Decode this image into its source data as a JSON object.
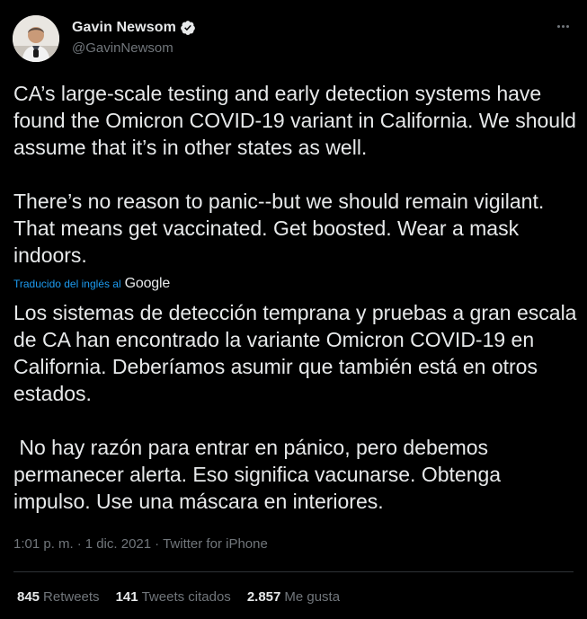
{
  "author": {
    "name": "Gavin Newsom",
    "handle": "@GavinNewsom"
  },
  "tweet": {
    "original_text": "CA’s large-scale testing and early detection systems have found the Omicron COVID-19 variant in California. We should assume that it’s in other states as well.\n\nThere’s no reason to panic--but we should remain vigilant. That means get vaccinated. Get boosted. Wear a mask indoors.",
    "translated_by_label": "Traducido del inglés al",
    "translator_brand": "Google",
    "translated_text": "Los sistemas de detección temprana y pruebas a gran escala de CA han encontrado la variante Omicron COVID-19 en California. Deberíamos asumir que también está en otros estados.\n\n No hay razón para entrar en pánico, pero debemos permanecer alerta. Eso significa vacunarse. Obtenga impulso. Use una máscara en interiores."
  },
  "meta": {
    "time": "1:01 p. m.",
    "sep1": "·",
    "date": "1 dic. 2021",
    "sep2": "·",
    "source": "Twitter for iPhone"
  },
  "stats": [
    {
      "count": "845",
      "label": "Retweets"
    },
    {
      "count": "141",
      "label": "Tweets citados"
    },
    {
      "count": "2.857",
      "label": "Me gusta"
    }
  ],
  "colors": {
    "background": "#000000",
    "text": "#e7e9ea",
    "secondary": "#71767b",
    "accent": "#1d9bf0",
    "divider": "#2f3336"
  },
  "icons": {
    "verified": "verified-badge-icon",
    "more": "more-dots-icon"
  }
}
